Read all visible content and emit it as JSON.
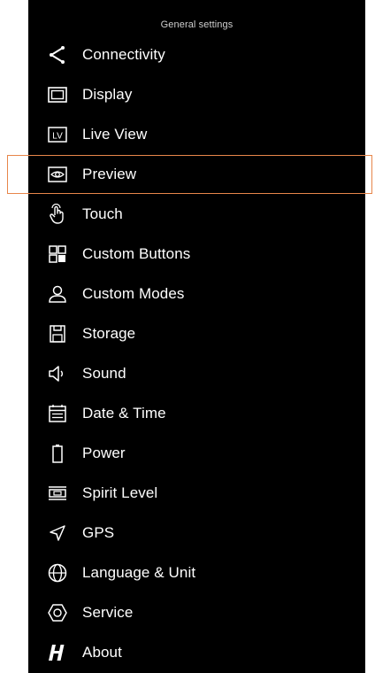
{
  "header": {
    "title": "General settings"
  },
  "highlight_color": "#e7864a",
  "menu": {
    "items": [
      {
        "label": "Connectivity",
        "icon": "share-icon"
      },
      {
        "label": "Display",
        "icon": "display-icon"
      },
      {
        "label": "Live View",
        "icon": "live-view-icon"
      },
      {
        "label": "Preview",
        "icon": "eye-icon",
        "selected": true
      },
      {
        "label": "Touch",
        "icon": "touch-hand-icon"
      },
      {
        "label": "Custom Buttons",
        "icon": "grid-buttons-icon"
      },
      {
        "label": "Custom Modes",
        "icon": "user-icon"
      },
      {
        "label": "Storage",
        "icon": "storage-card-icon"
      },
      {
        "label": "Sound",
        "icon": "speaker-icon"
      },
      {
        "label": "Date & Time",
        "icon": "calendar-icon"
      },
      {
        "label": "Power",
        "icon": "battery-icon"
      },
      {
        "label": "Spirit Level",
        "icon": "spirit-level-icon"
      },
      {
        "label": "GPS",
        "icon": "location-arrow-icon"
      },
      {
        "label": "Language & Unit",
        "icon": "globe-icon"
      },
      {
        "label": "Service",
        "icon": "hexagon-icon"
      },
      {
        "label": "About",
        "icon": "hasselblad-logo-icon"
      }
    ]
  }
}
